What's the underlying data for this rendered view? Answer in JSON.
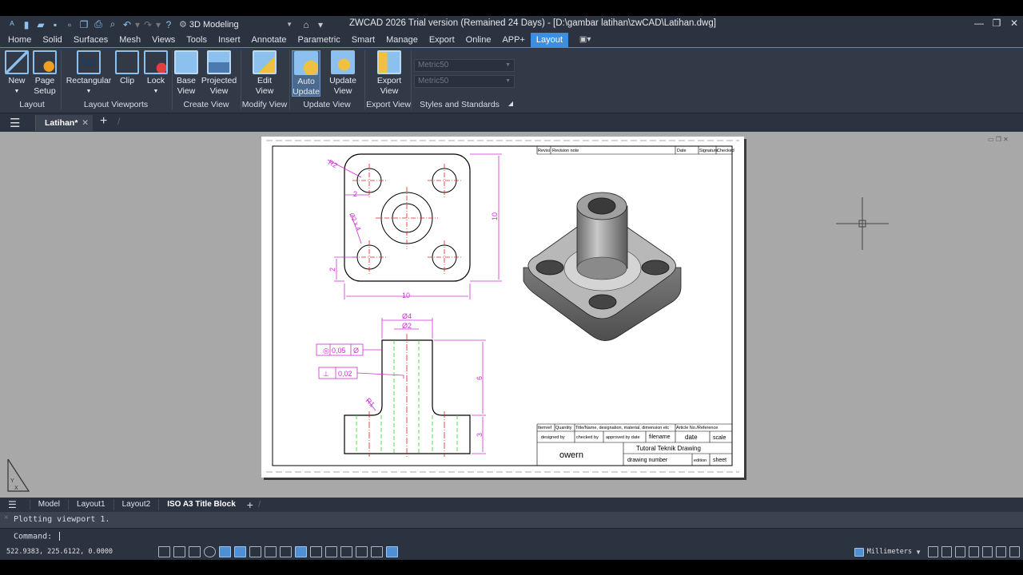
{
  "titlebar": {
    "workspace": "3D Modeling",
    "title": "ZWCAD 2026 Trial version (Remained 24 Days) - [D:\\gambar latihan\\zwCAD\\Latihan.dwg]"
  },
  "menu": [
    "Home",
    "Solid",
    "Surfaces",
    "Mesh",
    "Views",
    "Tools",
    "Insert",
    "Annotate",
    "Parametric",
    "Smart",
    "Manage",
    "Export",
    "Online",
    "APP+",
    "Layout"
  ],
  "ribbon": {
    "buttons": {
      "new": "New",
      "page": "Page",
      "setup": "Setup",
      "rect": "Rectangular",
      "clip": "Clip",
      "lock": "Lock",
      "base1": "Base",
      "base2": "View",
      "proj1": "Projected",
      "proj2": "View",
      "edit1": "Edit",
      "edit2": "View",
      "auto1": "Auto",
      "auto2": "Update",
      "upd1": "Update",
      "upd2": "View",
      "exp1": "Export",
      "exp2": "View"
    },
    "combo1": "Metric50",
    "combo2": "Metric50",
    "groups": {
      "layout": "Layout",
      "viewports": "Layout Viewports",
      "create": "Create View",
      "modify": "Modify View",
      "update": "Update View",
      "export": "Export View",
      "styles": "Styles and Standards"
    }
  },
  "doc_tab": "Latihan*",
  "drawing": {
    "dims": {
      "r2": "R2",
      "two_a": "2",
      "dia4x": "Ø2 x 4",
      "two_b": "2",
      "ten_v": "10",
      "ten_h": "10",
      "d4": "Ø4",
      "d2": "Ø2",
      "conc": "0,05",
      "perp": "0,02",
      "r1": "R1",
      "six": "6",
      "three": "3"
    },
    "revision": {
      "rev": "Revisi",
      "note": "Revision note",
      "date": "Date",
      "sig": "Signature",
      "checked": "Checked"
    },
    "title_block": {
      "item": "Itemref",
      "qty": "Quantity",
      "title_desc": "Title/Name, designation, material, dimension etc",
      "article": "Article No./Reference",
      "designed": "designed by",
      "checked": "checked by",
      "approved": "approved by date",
      "filename": "filename",
      "date": "date",
      "scale": "scale",
      "owner": "owern",
      "drawing_title": "Tutoral Teknik Drawing",
      "drawing_number": "drawing number",
      "edition": "edition",
      "sheet": "sheet"
    }
  },
  "layout_tabs": [
    "Model",
    "Layout1",
    "Layout2",
    "ISO A3 Title Block"
  ],
  "command": {
    "history": "Plotting viewport 1.",
    "prompt": "Command:"
  },
  "status": {
    "coords": "522.9383, 225.6122, 0.0000",
    "units": "Millimeters"
  },
  "colors": {
    "accent": "#3d8ee0",
    "dimension": "#d22dd2",
    "centerline": "#e0241c",
    "hidden": "#2fcf2f"
  }
}
